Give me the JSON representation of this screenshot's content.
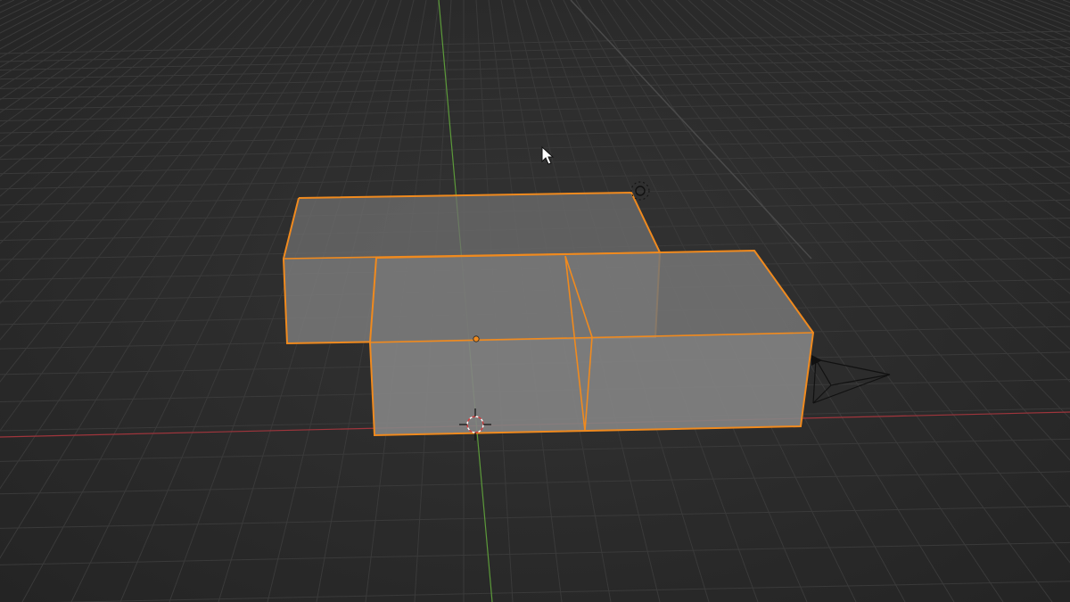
{
  "viewport": {
    "editor": "3D Viewport",
    "background_color": "#2b2b2b",
    "grid_color": "#3a3a3a",
    "x_axis_color": "#a0353c",
    "y_axis_color": "#5c9a3a",
    "selection_outline_color": "#f08a1e",
    "mesh_face_color": "#7d7d7d"
  },
  "scene_objects": [
    {
      "name": "mesh-object-back",
      "type": "mesh",
      "selected": true
    },
    {
      "name": "mesh-object-front",
      "type": "mesh",
      "selected": true
    },
    {
      "name": "camera-object",
      "type": "camera",
      "selected": false
    },
    {
      "name": "light-object",
      "type": "light",
      "selected": false
    }
  ],
  "gizmos": {
    "origin_dot": "object-origin",
    "cursor": "3d-cursor",
    "pointer": "mouse-pointer"
  }
}
